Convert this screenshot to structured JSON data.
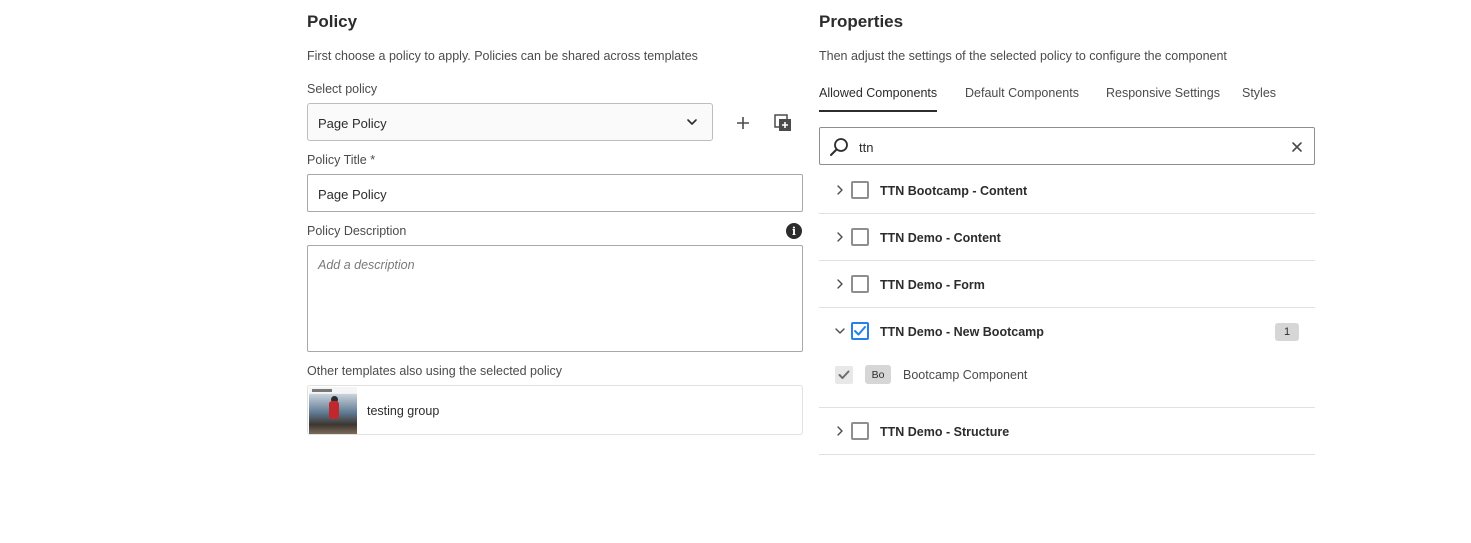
{
  "policy": {
    "heading": "Policy",
    "description": "First choose a policy to apply. Policies can be shared across templates",
    "select_label": "Select policy",
    "select_value": "Page Policy",
    "title_label": "Policy Title *",
    "title_value": "Page Policy",
    "description_label": "Policy Description",
    "description_placeholder": "Add a description",
    "other_templates_label": "Other templates also using the selected policy",
    "templates": [
      {
        "name": "testing group"
      }
    ]
  },
  "properties": {
    "heading": "Properties",
    "description": "Then adjust the settings of the selected policy to configure the component",
    "tabs": [
      {
        "label": "Allowed Components",
        "active": true
      },
      {
        "label": "Default Components",
        "active": false
      },
      {
        "label": "Responsive Settings",
        "active": false
      },
      {
        "label": "Styles",
        "active": false
      }
    ],
    "search_value": "ttn",
    "groups": [
      {
        "label": "TTN Bootcamp - Content",
        "checked": false,
        "expanded": false
      },
      {
        "label": "TTN Demo - Content",
        "checked": false,
        "expanded": false
      },
      {
        "label": "TTN Demo - Form",
        "checked": false,
        "expanded": false
      },
      {
        "label": "TTN Demo - New Bootcamp",
        "checked": true,
        "expanded": true,
        "count": "1",
        "children": [
          {
            "abbr": "Bo",
            "name": "Bootcamp Component",
            "checked": true
          }
        ]
      },
      {
        "label": "TTN Demo - Structure",
        "checked": false,
        "expanded": false
      }
    ]
  },
  "icons": {
    "select_chevron": "chevron-down-icon",
    "add": "plus-icon",
    "duplicate": "copy-add-icon",
    "info": "info-icon",
    "search": "search-icon",
    "clear": "close-icon",
    "expand": "chevron-right-icon",
    "collapse": "chevron-down-icon",
    "check": "checkmark-icon"
  },
  "colors": {
    "accent": "#2680eb",
    "text": "#2c2c2c",
    "border": "#a8a8a8"
  }
}
